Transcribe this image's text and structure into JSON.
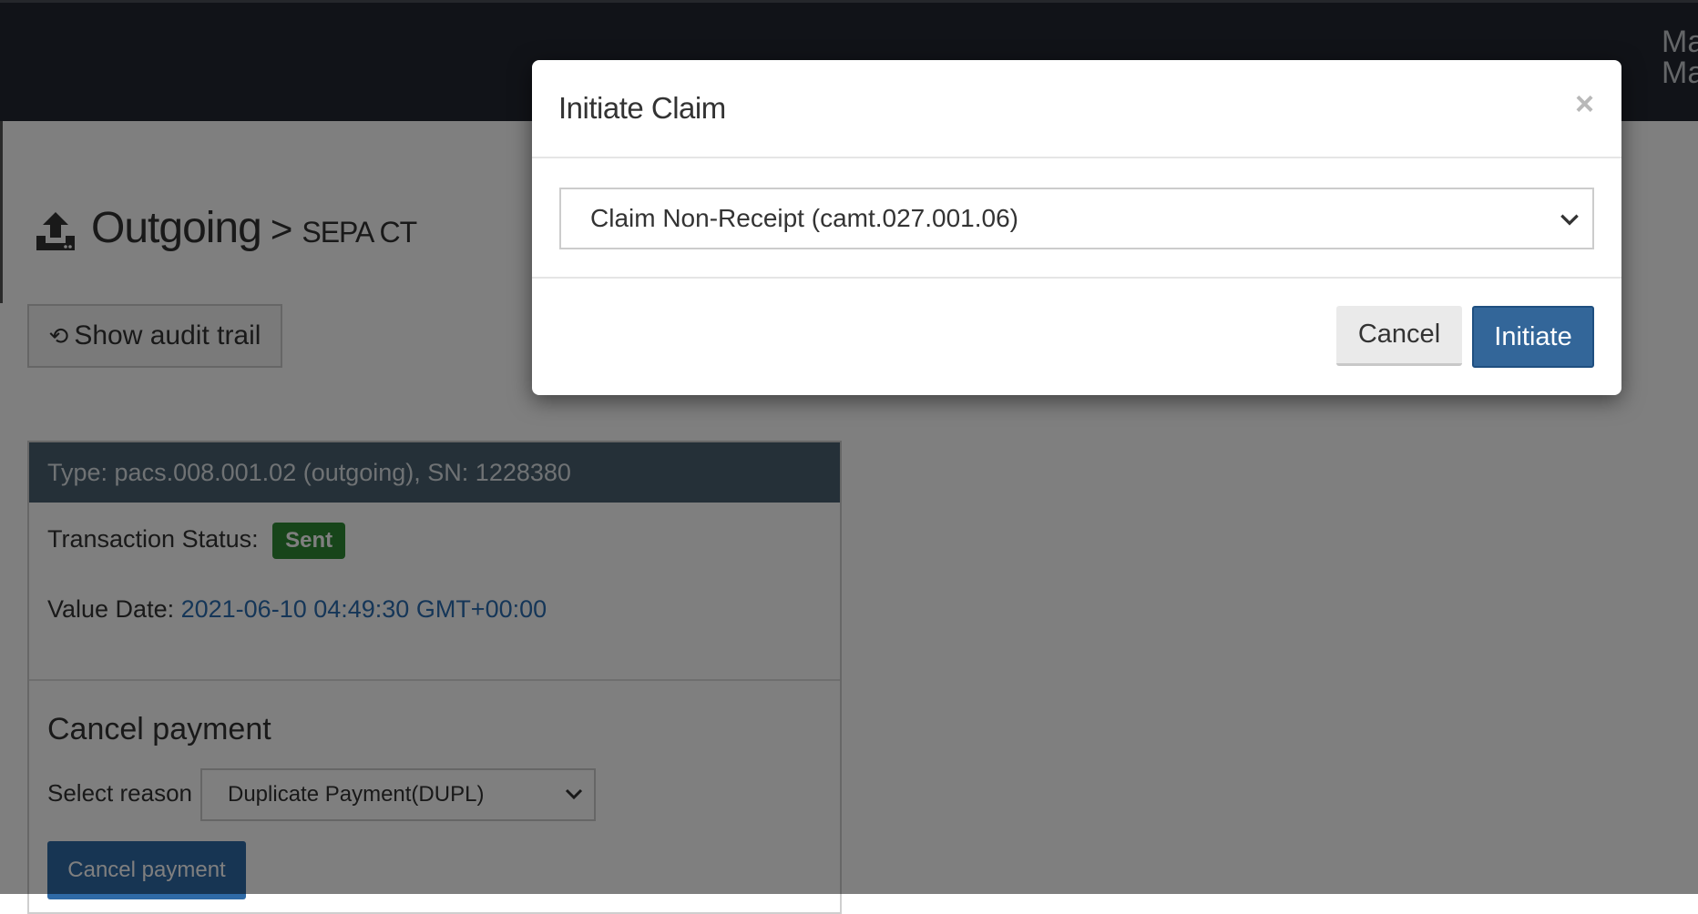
{
  "header": {
    "user_line1": "Ma",
    "user_line2": "Ma"
  },
  "page": {
    "title": "Outgoing",
    "separator": ">",
    "subtitle": "SEPA CT",
    "audit_button": "Show audit trail"
  },
  "panel": {
    "header": "Type: pacs.008.001.02 (outgoing), SN: 1228380",
    "status_label": "Transaction Status:",
    "status_value": "Sent",
    "value_date_label": "Value Date:",
    "value_date": "2021-06-10 04:49:30 GMT+00:00",
    "cancel_section_title": "Cancel payment",
    "reason_label": "Select reason",
    "reason_selected": "Duplicate Payment(DUPL)",
    "cancel_button": "Cancel payment"
  },
  "modal": {
    "title": "Initiate Claim",
    "close": "×",
    "claim_selected": "Claim Non-Receipt (camt.027.001.06)",
    "cancel_button": "Cancel",
    "initiate_button": "Initiate"
  },
  "colors": {
    "topbar": "#222730",
    "status_badge": "#2e8a34",
    "primary_button": "#336699",
    "panel_header": "#4a6070",
    "link": "#2a6cb0"
  },
  "icons": {
    "heading": "upload-tray-icon",
    "audit": "history-icon",
    "close": "close-icon",
    "dropdown": "chevron-down-icon"
  }
}
